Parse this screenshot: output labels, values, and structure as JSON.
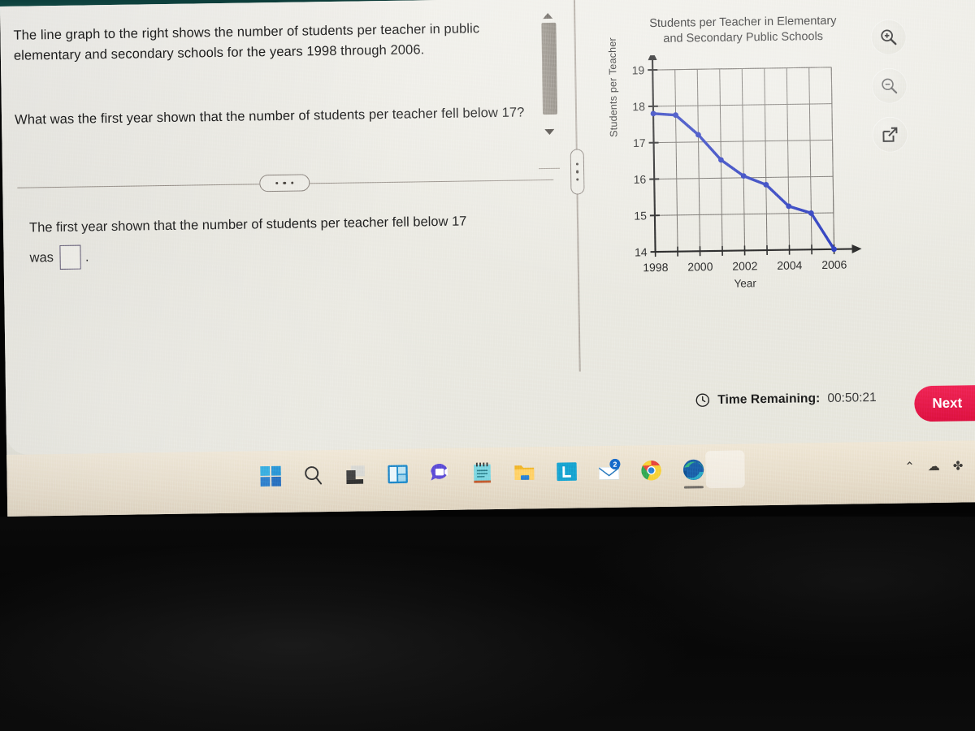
{
  "question": {
    "paragraph_1": "The line graph to the right shows the number of students per teacher in public elementary and secondary schools for the years 1998 through 2006.",
    "paragraph_2": "What was the first year shown that the number of students per teacher fell below 17?",
    "answer_prompt": "The first year shown that the number of students per teacher fell below 17",
    "answer_prompt_tail": "was",
    "answer_value": "",
    "answer_period": "."
  },
  "chart_data": {
    "type": "line",
    "title": "Students per Teacher in Elementary and Secondary Public Schools",
    "title_line_1": "Students per Teacher in Elementary",
    "title_line_2": "and Secondary Public Schools",
    "xlabel": "Year",
    "ylabel": "Students per Teacher",
    "x": [
      1998,
      1999,
      2000,
      2001,
      2002,
      2003,
      2004,
      2005,
      2006
    ],
    "values": [
      17.8,
      17.75,
      17.2,
      16.5,
      16.05,
      15.8,
      15.2,
      15.0,
      14.0
    ],
    "xticks": [
      1998,
      2000,
      2002,
      2004,
      2006
    ],
    "yticks": [
      14,
      15,
      16,
      17,
      18,
      19
    ],
    "xlim": [
      1998,
      2006
    ],
    "ylim": [
      14,
      19
    ],
    "grid": true,
    "legend": "none",
    "series_color": "#2233bb",
    "marker": "circle"
  },
  "chart_tools": [
    {
      "name": "zoom-in-icon",
      "label": "Zoom In"
    },
    {
      "name": "zoom-out-icon",
      "label": "Zoom Out"
    },
    {
      "name": "open-in-new-window-icon",
      "label": "Open in new window"
    }
  ],
  "footer": {
    "clock_icon": "clock-icon",
    "time_label": "Time Remaining:",
    "time_value": "00:50:21",
    "next_label": "Next"
  },
  "taskbar": {
    "items": [
      {
        "name": "start-button",
        "label": "Start"
      },
      {
        "name": "search-icon",
        "label": "Search"
      },
      {
        "name": "task-view-icon",
        "label": "Task View"
      },
      {
        "name": "widgets-icon",
        "label": "Widgets"
      },
      {
        "name": "chat-icon",
        "label": "Chat"
      },
      {
        "name": "notepad-icon",
        "label": "Notepad"
      },
      {
        "name": "file-explorer-icon",
        "label": "File Explorer"
      },
      {
        "name": "lockdown-browser-icon",
        "label": "L"
      },
      {
        "name": "mail-icon",
        "label": "Mail",
        "badge": "2"
      },
      {
        "name": "chrome-icon",
        "label": "Google Chrome"
      },
      {
        "name": "edge-icon",
        "label": "Microsoft Edge"
      }
    ],
    "tray": [
      {
        "name": "tray-chevron-up-icon",
        "glyph": "⌃"
      },
      {
        "name": "tray-onedrive-icon",
        "glyph": "☁"
      },
      {
        "name": "tray-network-icon",
        "glyph": "✤"
      },
      {
        "name": "tray-volume-icon",
        "glyph": "⧸"
      }
    ]
  },
  "colors": {
    "accent_red": "#e8194b",
    "line_blue": "#2233bb",
    "panel_bg": "#eceae3",
    "taskbar_bg": "#e6dcc9"
  }
}
